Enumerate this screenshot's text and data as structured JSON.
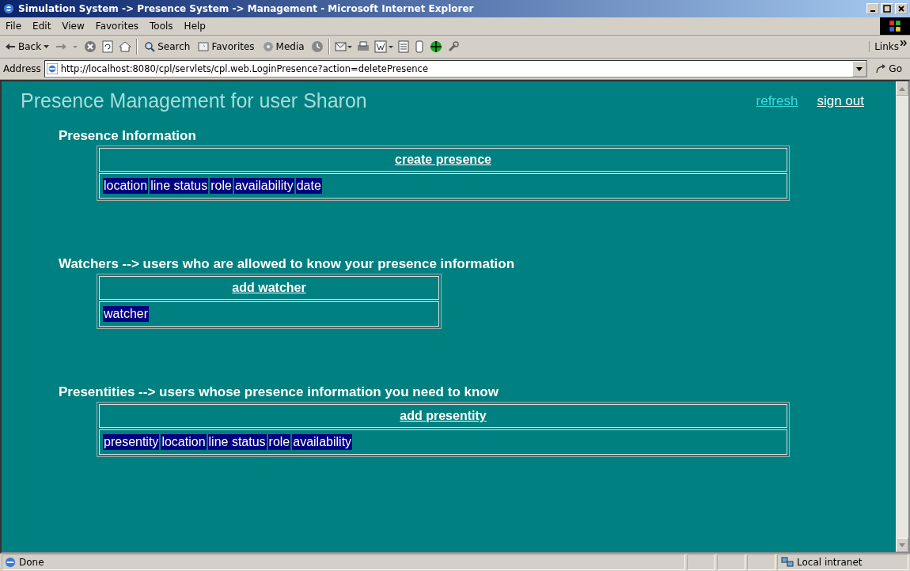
{
  "window": {
    "title": "Simulation System -> Presence System -> Management - Microsoft Internet Explorer"
  },
  "menu": [
    "File",
    "Edit",
    "View",
    "Favorites",
    "Tools",
    "Help"
  ],
  "toolbar": {
    "back": "Back",
    "search": "Search",
    "favorites": "Favorites",
    "media": "Media",
    "links": "Links"
  },
  "address": {
    "label": "Address",
    "value": "http://localhost:8080/cpl/servlets/cpl.web.LoginPresence?action=deletePresence",
    "go": "Go"
  },
  "page": {
    "heading": "Presence Management for user Sharon",
    "links": [
      {
        "label": "refresh",
        "visited": true
      },
      {
        "label": "sign out",
        "visited": false
      }
    ],
    "sections": [
      {
        "title": "Presence Information",
        "action": "create presence",
        "columns": [
          "location",
          "line status",
          "role",
          "availability",
          "date"
        ],
        "wide": true
      },
      {
        "title": "Watchers --> users who are allowed to know your presence information",
        "action": "add watcher",
        "columns": [
          "watcher"
        ],
        "wide": false
      },
      {
        "title": "Presentities --> users whose presence information you need to know",
        "action": "add presentity",
        "columns": [
          "presentity",
          "location",
          "line status",
          "role",
          "availability"
        ],
        "wide": true
      }
    ]
  },
  "status_bar": {
    "text": "Done",
    "zone": "Local intranet"
  }
}
